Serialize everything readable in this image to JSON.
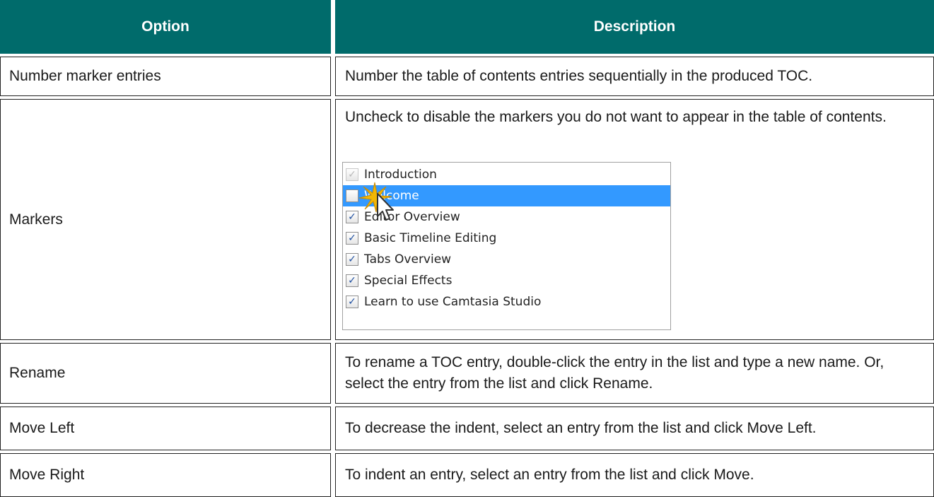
{
  "header": {
    "option": "Option",
    "description": "Description"
  },
  "rows": [
    {
      "option": "Number marker entries",
      "description": "Number the table of contents entries sequentially in the produced TOC."
    },
    {
      "option": "Markers",
      "description": "Uncheck to disable the markers you do not want to appear in the table of contents."
    },
    {
      "option": "Rename",
      "description": "To rename a TOC entry, double-click the entry in the list and type a new name. Or, select the entry from the list and click Rename."
    },
    {
      "option": "Move Left",
      "description": "To decrease the indent, select an entry from the list and click Move Left."
    },
    {
      "option": "Move Right",
      "description": "To indent an entry, select an entry from the list and click Move."
    }
  ],
  "markers_list": [
    {
      "label": "Introduction",
      "checked": true,
      "disabled": true,
      "selected": false
    },
    {
      "label": "Welcome",
      "checked": false,
      "disabled": false,
      "selected": true
    },
    {
      "label": "Editor Overview",
      "checked": true,
      "disabled": false,
      "selected": false
    },
    {
      "label": "Basic Timeline Editing",
      "checked": true,
      "disabled": false,
      "selected": false
    },
    {
      "label": "Tabs Overview",
      "checked": true,
      "disabled": false,
      "selected": false
    },
    {
      "label": "Special Effects",
      "checked": true,
      "disabled": false,
      "selected": false
    },
    {
      "label": "Learn to use Camtasia Studio",
      "checked": true,
      "disabled": false,
      "selected": false
    }
  ],
  "colors": {
    "header_bg": "#006b6b",
    "selection": "#3399ff"
  },
  "icons": {
    "cursor": "arrow-pointer-click-icon",
    "check": "checkmark-icon"
  }
}
